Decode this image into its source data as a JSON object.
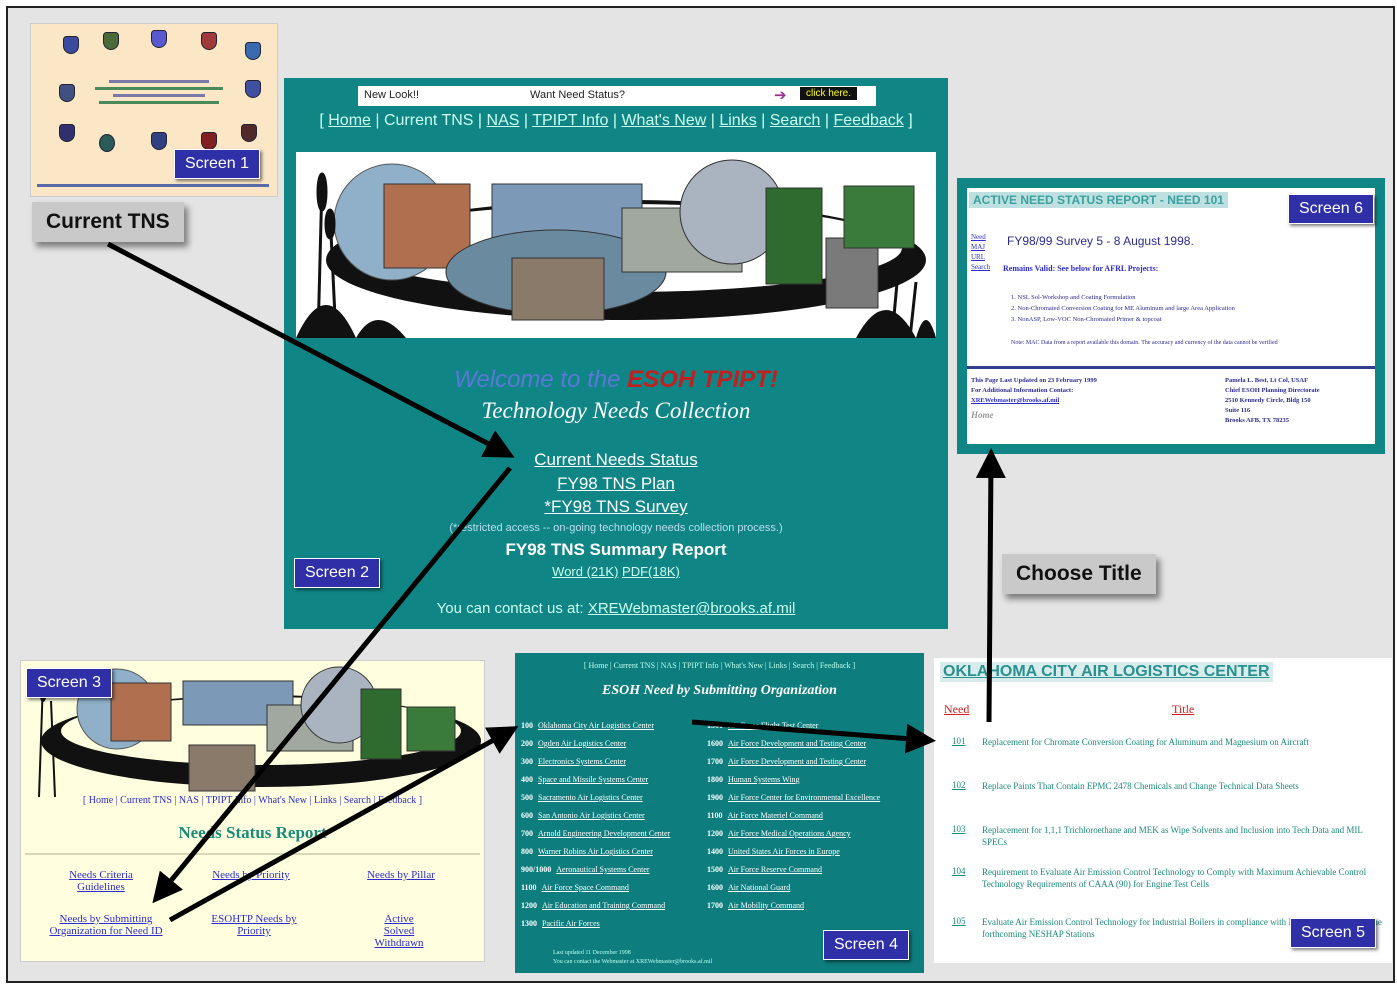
{
  "screen_labels": {
    "s1": "Screen 1",
    "s2": "Screen 2",
    "s3": "Screen 3",
    "s4": "Screen 4",
    "s5": "Screen 5",
    "s6": "Screen 6"
  },
  "callouts": {
    "current_tns": "Current TNS",
    "choose_title": "Choose Title"
  },
  "screen2": {
    "new_look": "New Look!!",
    "want_status": "Want Need Status?",
    "click_here": "click here.",
    "nav": [
      "Home",
      "Current TNS",
      "NAS",
      "TPIPT Info",
      "What's New",
      "Links",
      "Search",
      "Feedback"
    ],
    "welcome_prefix": "Welcome to the ",
    "welcome_brand": "ESOH TPIPT!",
    "subtitle": "Technology Needs Collection",
    "link_current": "Current Needs Status",
    "link_plan": "FY98 TNS Plan",
    "link_survey": "*FY98 TNS Survey",
    "restricted": "(*restricted access -- on-going technology needs collection process.)",
    "summary": "FY98 TNS Summary Report",
    "word": "Word (21K)",
    "pdf": "PDF(18K)",
    "contact_prefix": "You can contact us at: ",
    "contact_email": "XREWebmaster@brooks.af.mil"
  },
  "screen3": {
    "nav": "[ Home | Current TNS | NAS | TPIPT Info | What's New | Links | Search | Feedback ]",
    "title": "Needs Status Report",
    "links": {
      "criteria": "Needs Criteria Guidelines",
      "priority": "Needs by Priority",
      "pillar": "Needs by Pillar",
      "submitting": "Needs by Submitting Organization for Need ID",
      "esohtp": "ESOHTP Needs by Priority",
      "active": "Active Solved Withdrawn"
    }
  },
  "screen4": {
    "nav": "[ Home | Current TNS | NAS | TPIPT Info | What's New | Links | Search | Feedback ]",
    "title": "ESOH Need by Submitting Organization",
    "left_items": [
      {
        "code": "100",
        "org": "Oklahoma City Air Logistics Center"
      },
      {
        "code": "200",
        "org": "Ogden Air Logistics Center"
      },
      {
        "code": "300",
        "org": "Electronics Systems Center"
      },
      {
        "code": "400",
        "org": "Space and Missile Systems Center"
      },
      {
        "code": "500",
        "org": "Sacramento Air Logistics Center"
      },
      {
        "code": "600",
        "org": "San Antonio Air Logistics Center"
      },
      {
        "code": "700",
        "org": "Arnold Engineering Development Center"
      },
      {
        "code": "800",
        "org": "Warner Robins Air Logistics Center"
      },
      {
        "code": "900/1000",
        "org": "Aeronautical Systems Center"
      },
      {
        "code": "1100",
        "org": "Air Force Space Command"
      },
      {
        "code": "1200",
        "org": "Air Education and Training Command"
      },
      {
        "code": "1300",
        "org": "Pacific Air Forces"
      }
    ],
    "right_items": [
      {
        "code": "1500",
        "org": "Air Force Flight Test Center"
      },
      {
        "code": "1600",
        "org": "Air Force Development and Testing Center"
      },
      {
        "code": "1700",
        "org": "Air Force Development and Testing Center"
      },
      {
        "code": "1800",
        "org": "Human Systems Wing"
      },
      {
        "code": "1900",
        "org": "Air Force Center for Environmental Excellence"
      },
      {
        "code": "1100",
        "org": "Air Force Materiel Command"
      },
      {
        "code": "1200",
        "org": "Air Force Medical Operations Agency"
      },
      {
        "code": "1400",
        "org": "United States Air Forces in Europe"
      },
      {
        "code": "1500",
        "org": "Air Force Reserve Command"
      },
      {
        "code": "1600",
        "org": "Air National Guard"
      },
      {
        "code": "1700",
        "org": "Air Mobility Command"
      }
    ],
    "footer1": "Last updated 11 December 1998",
    "footer2": "You can contact the Webmaster at XREWebmaster@brooks.af.mil"
  },
  "screen5": {
    "title": "OKLAHOMA CITY AIR LOGISTICS CENTER",
    "col_need": "Need",
    "col_title": "Title",
    "rows": [
      {
        "need": "101",
        "title": "Replacement for Chromate Conversion Coating for Aluminum and Magnesium on Aircraft"
      },
      {
        "need": "102",
        "title": "Replace Paints That Contain EPMC 2478 Chemicals and Change Technical Data Sheets"
      },
      {
        "need": "103",
        "title": "Replacement for 1,1,1 Trichloroethane and MEK as Wipe Solvents and Inclusion into Tech Data and MIL SPECs"
      },
      {
        "need": "104",
        "title": "Requirement to Evaluate Air Emission Control Technology to Comply with Maximum Achievable Control Technology Requirements of CAAA (90) for Engine Test Cells"
      },
      {
        "need": "105",
        "title": "Evaluate Air Emission Control Technology for Industrial Boilers in compliance with NSPS Subpart Db and the forthcoming NESHAP Stations"
      }
    ]
  },
  "screen6": {
    "title": "ACTIVE NEED STATUS REPORT - NEED 101",
    "side_links": [
      "Need",
      "MAJ",
      "URL",
      "Search"
    ],
    "survey": "FY98/99 Survey 5 - 8 August 1998.",
    "remains": "Remains Valid: See below for AFRL Projects:",
    "projects": [
      "1. NSL Sol-Workshop and Coating Formulation",
      "2. Non-Chromated Conversion Coating for ME Aluminum and large Area Application",
      "3. NonASP, Low-VOC Non-Chromated Primer & topcoat"
    ],
    "note": "Note: MAC Data from a report available this domain. The accuracy and currency of the data cannot be verified",
    "updated": "This Page Last Updated on 23 February 1999",
    "for_info": "For Additional Information Contact:",
    "email": "XREWebmaster@brooks.af.mil",
    "home": "Home",
    "contact": [
      "Pamela L. Best, Lt Col, USAF",
      "Chief ESOH Planning Directorate",
      "2510 Kennedy Circle, Bldg 150",
      "Suite 116",
      "Brooks AFB, TX 78235"
    ]
  },
  "colors": {
    "teal": "#0f8585",
    "label_blue": "#2f2fa8",
    "link_blue": "#2c2ccf",
    "need_red": "#d02020"
  }
}
